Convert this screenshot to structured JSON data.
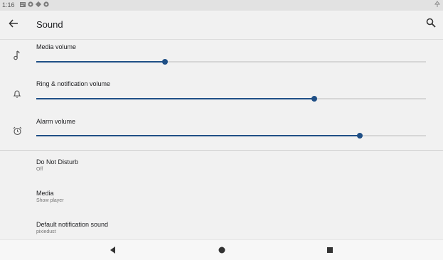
{
  "status_bar": {
    "time": "1:16",
    "icons": [
      "sim-icon",
      "notification-icon",
      "settings-icon",
      "notification-icon"
    ],
    "right_icon": "signal-icon"
  },
  "app_bar": {
    "title": "Sound",
    "back_icon": "arrow-back-icon",
    "search_icon": "search-icon"
  },
  "volumes": [
    {
      "label": "Media volume",
      "icon": "music-note-icon",
      "level": 0.33
    },
    {
      "label": "Ring & notification volume",
      "icon": "bell-icon",
      "level": 0.714
    },
    {
      "label": "Alarm volume",
      "icon": "alarm-clock-icon",
      "level": 0.831
    }
  ],
  "preferences": [
    {
      "title": "Do Not Disturb",
      "subtitle": "Off"
    },
    {
      "title": "Media",
      "subtitle": "Show player"
    },
    {
      "title": "Default notification sound",
      "subtitle": "pixiedust"
    }
  ],
  "nav_bar": {
    "back": "triangle-back-icon",
    "home": "circle-home-icon",
    "recents": "square-recents-icon"
  },
  "colors": {
    "accent": "#1f4f86",
    "background": "#f1f1f1"
  }
}
